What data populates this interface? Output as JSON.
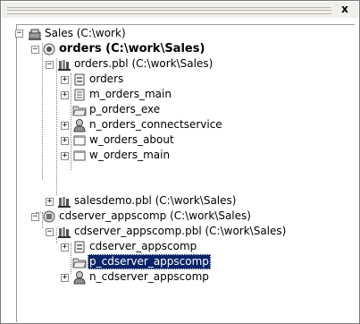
{
  "window": {
    "close_label": "x"
  },
  "tree": {
    "workspace": {
      "label": "Sales (C:\\work)",
      "expander": "−"
    },
    "target_orders": {
      "label": "orders (C:\\work\\Sales)",
      "expander": "−"
    },
    "lib_orders": {
      "label": "orders.pbl (C:\\work\\Sales)",
      "expander": "−"
    },
    "obj_orders_app": {
      "label": "orders",
      "expander": "+"
    },
    "obj_m_orders_main": {
      "label": "m_orders_main",
      "expander": "+"
    },
    "obj_p_orders_exe": {
      "label": "p_orders_exe"
    },
    "obj_n_orders_connectservice": {
      "label": "n_orders_connectservice",
      "expander": "+"
    },
    "obj_w_orders_about": {
      "label": "w_orders_about",
      "expander": "+"
    },
    "obj_w_orders_main": {
      "label": "w_orders_main",
      "expander": "+"
    },
    "lib_salesdemo": {
      "label": "salesdemo.pbl (C:\\work\\Sales)",
      "expander": "+"
    },
    "target_cdserver": {
      "label": "cdserver_appscomp (C:\\work\\Sales)",
      "expander": "−"
    },
    "lib_cdserver": {
      "label": "cdserver_appscomp.pbl (C:\\work\\Sales)",
      "expander": "−"
    },
    "obj_cdserver_app": {
      "label": "cdserver_appscomp",
      "expander": "+"
    },
    "obj_p_cdserver": {
      "label": "p_cdserver_appscomp",
      "selected": true
    },
    "obj_n_cdserver": {
      "label": "n_cdserver_appscomp",
      "expander": "+"
    }
  },
  "colors": {
    "selection": "#0a246a",
    "frame": "#f0efe9"
  }
}
